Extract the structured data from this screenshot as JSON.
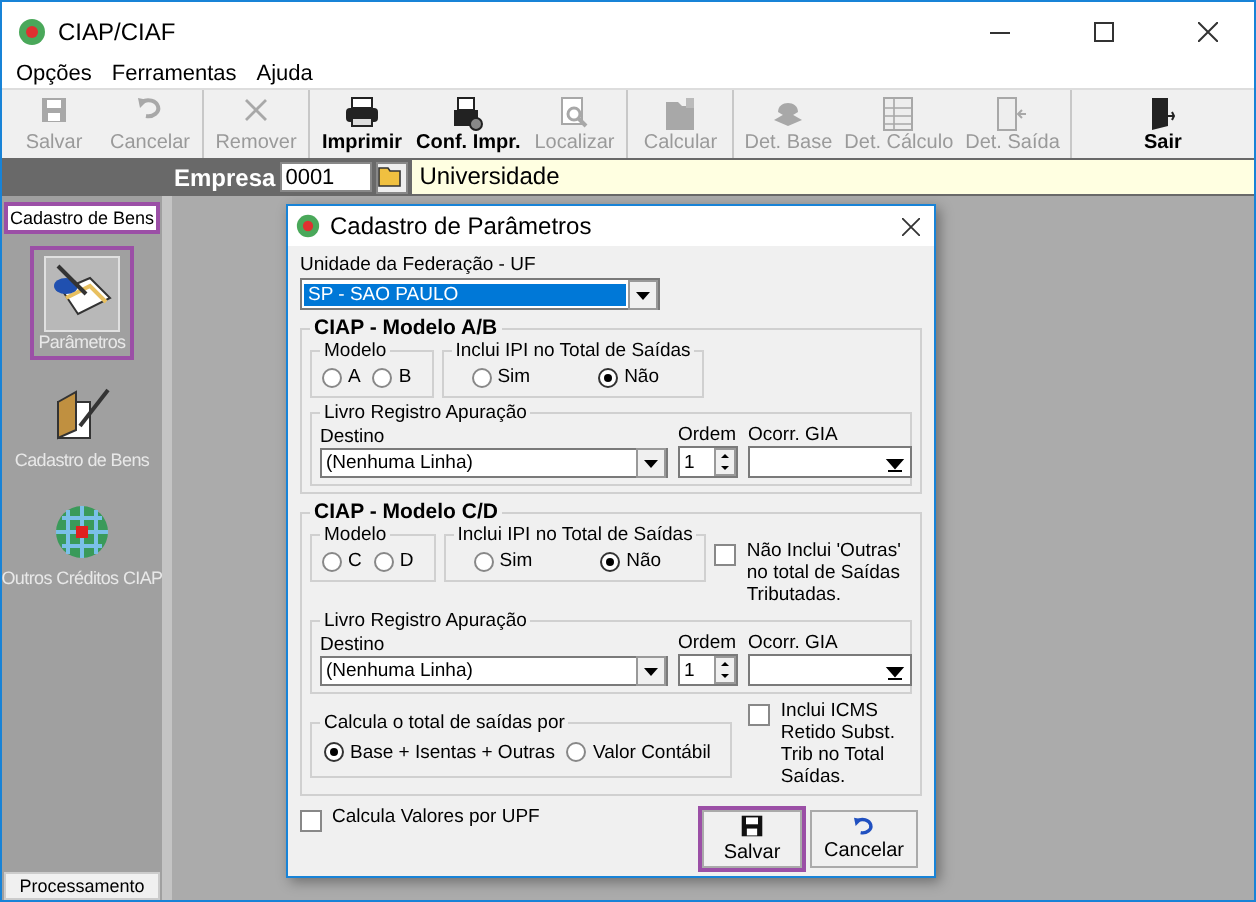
{
  "window": {
    "title": "CIAP/CIAF"
  },
  "menu": [
    "Opções",
    "Ferramentas",
    "Ajuda"
  ],
  "toolbar_groups": [
    {
      "buttons": [
        {
          "label": "Salvar",
          "kind": "save",
          "disabled": true
        },
        {
          "label": "Cancelar",
          "kind": "undo",
          "disabled": true
        }
      ]
    },
    {
      "buttons": [
        {
          "label": "Remover",
          "kind": "remove",
          "disabled": true
        }
      ]
    },
    {
      "buttons": [
        {
          "label": "Imprimir",
          "kind": "print",
          "disabled": false
        },
        {
          "label": "Conf. Impr.",
          "kind": "printconf",
          "disabled": false
        },
        {
          "label": "Localizar",
          "kind": "find",
          "disabled": true
        }
      ]
    },
    {
      "buttons": [
        {
          "label": "Calcular",
          "kind": "calc",
          "disabled": true
        }
      ]
    },
    {
      "buttons": [
        {
          "label": "Det. Base",
          "kind": "base",
          "disabled": true
        },
        {
          "label": "Det. Cálculo",
          "kind": "sheet",
          "disabled": true
        },
        {
          "label": "Det. Saída",
          "kind": "exitdoc",
          "disabled": true
        }
      ]
    },
    {
      "buttons": [
        {
          "label": "Sair",
          "kind": "door",
          "disabled": false
        }
      ]
    }
  ],
  "empresa": {
    "label": "Empresa",
    "code": "0001",
    "name": "Universidade"
  },
  "sidebar": {
    "header": "Cadastro de Bens",
    "items": [
      {
        "label": "Parâmetros",
        "kind": "params",
        "selected": true
      },
      {
        "label": "Cadastro de Bens",
        "kind": "register",
        "selected": false
      },
      {
        "label": "Outros Créditos CIAP",
        "kind": "globe",
        "selected": false
      }
    ],
    "footer": "Processamento"
  },
  "dialog": {
    "title": "Cadastro de Parâmetros",
    "uf_label": "Unidade da Federação - UF",
    "uf_value": "SP - SAO PAULO",
    "sections": [
      {
        "title": "CIAP - Modelo A/B",
        "modelo_label": "Modelo",
        "modelo": [
          {
            "label": "A",
            "selected": false
          },
          {
            "label": "B",
            "selected": false
          }
        ],
        "ipi_label": "Inclui IPI no Total de Saídas",
        "ipi": [
          {
            "label": "Sim",
            "selected": false
          },
          {
            "label": "Não",
            "selected": true
          }
        ],
        "livro": {
          "label": "Livro Registro Apuração",
          "destino_label": "Destino",
          "destino": "(Nenhuma Linha)",
          "ordem_label": "Ordem",
          "ordem": "1",
          "gia_label": "Ocorr. GIA"
        }
      },
      {
        "title": "CIAP - Modelo C/D",
        "modelo_label": "Modelo",
        "modelo": [
          {
            "label": "C",
            "selected": false
          },
          {
            "label": "D",
            "selected": false
          }
        ],
        "ipi_label": "Inclui IPI no Total de Saídas",
        "ipi": [
          {
            "label": "Sim",
            "selected": false
          },
          {
            "label": "Não",
            "selected": true
          }
        ],
        "extra_check": {
          "label": "Não Inclui 'Outras' no total de Saídas  Tributadas.",
          "checked": false
        },
        "livro": {
          "label": "Livro Registro Apuração",
          "destino_label": "Destino",
          "destino": "(Nenhuma Linha)",
          "ordem_label": "Ordem",
          "ordem": "1",
          "gia_label": "Ocorr. GIA"
        },
        "calc": {
          "label": "Calcula o total de saídas por",
          "options": [
            {
              "label": "Base + Isentas + Outras",
              "selected": true
            },
            {
              "label": "Valor Contábil",
              "selected": false
            }
          ]
        },
        "calc_check": {
          "label": "Inclui ICMS Retido Subst. Trib no Total Saídas.",
          "checked": false
        }
      }
    ],
    "upf": {
      "label": "Calcula Valores por UPF",
      "checked": false
    },
    "buttons": [
      {
        "label": "Salvar",
        "kind": "save",
        "focused": true
      },
      {
        "label": "Cancelar",
        "kind": "undo",
        "focused": false
      }
    ]
  }
}
